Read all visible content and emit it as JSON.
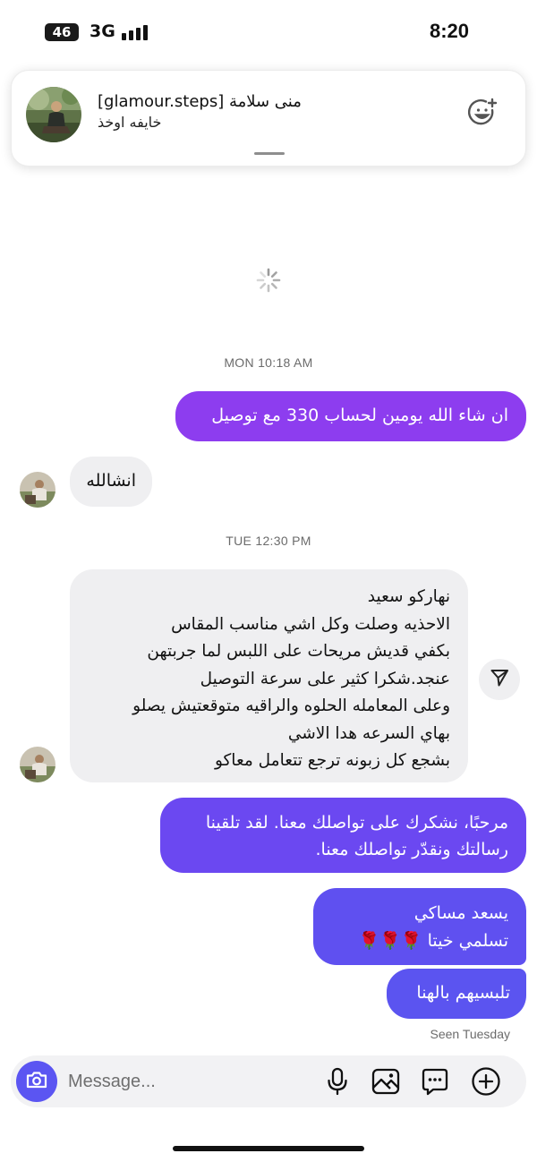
{
  "status_bar": {
    "network_badge": "46",
    "network_type": "3G",
    "time": "8:20"
  },
  "header": {
    "name": "[glamour.steps] منى سلامة",
    "subtitle": "خايفه اوخذ",
    "avatar_icon": "profile-photo",
    "action_icon": "add-reaction-icon"
  },
  "conversation": {
    "timestamps": [
      "MON 10:18 AM",
      "TUE 12:30 PM"
    ],
    "messages": [
      {
        "direction": "out",
        "lines": [
          "ان شاء الله يومين لحساب 330 مع توصيل"
        ]
      },
      {
        "direction": "in",
        "lines": [
          "انشالله"
        ]
      },
      {
        "direction": "in",
        "lines": [
          "نهاركو سعيد",
          "الاحذيه وصلت وكل اشي مناسب المقاس",
          "بكفي قديش مريحات على اللبس لما جربتهن",
          "عنجد.شكرا كثير على سرعة التوصيل",
          "وعلى المعامله الحلوه والراقيه  متوقعتيش يصلو",
          "بهاي السرعه هدا الاشي",
          "بشجع كل زبونه ترجع تتعامل معاكو"
        ]
      },
      {
        "direction": "out",
        "lines": [
          "مرحبًا، نشكرك على تواصلك معنا. لقد تلقينا",
          "رسالتك ونقدّر تواصلك معنا."
        ]
      },
      {
        "direction": "out",
        "lines": [
          "يسعد مساكي",
          "تسلمي خيتا 🌹🌹🌹"
        ]
      },
      {
        "direction": "out",
        "lines": [
          "تلبسيهم بالهنا"
        ]
      }
    ],
    "seen_label": "Seen Tuesday"
  },
  "composer": {
    "placeholder": "Message...",
    "icons": [
      "camera-icon",
      "microphone-icon",
      "gallery-icon",
      "sticker-icon",
      "plus-icon"
    ]
  },
  "colors": {
    "accent": "#5b55f2",
    "bubble_out_top": "#8a3ef0",
    "bubble_out_bottom": "#5a52f0",
    "bubble_in": "#efeff1"
  }
}
